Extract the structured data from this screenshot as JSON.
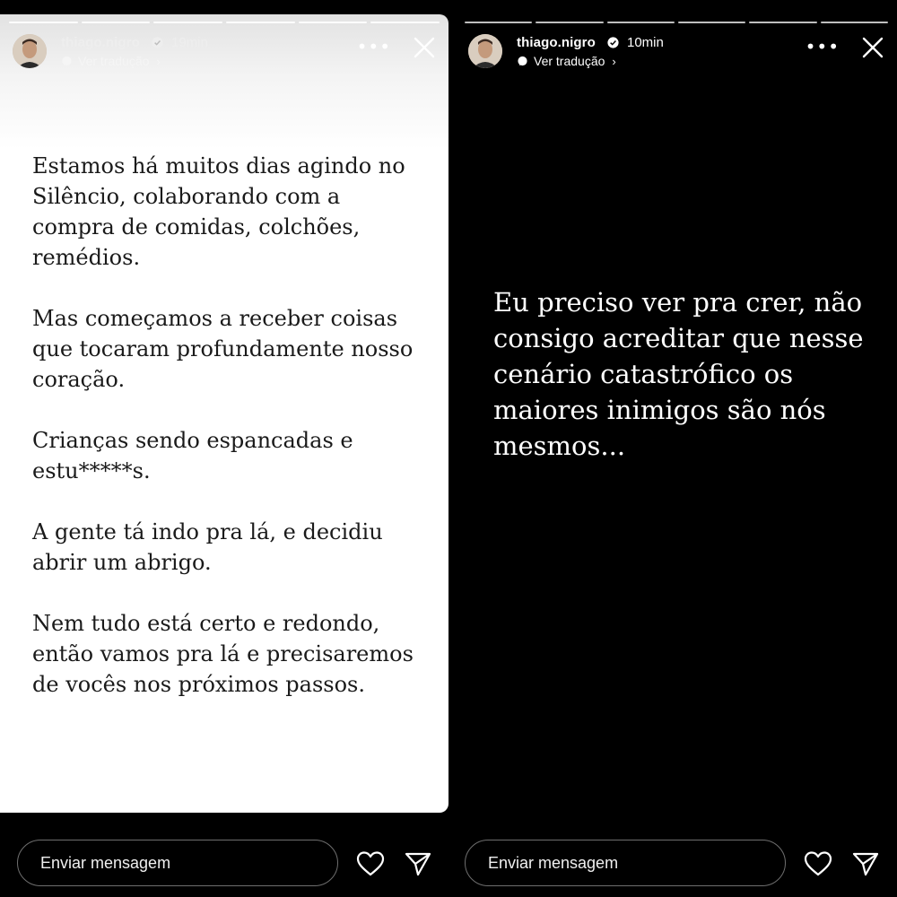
{
  "stories": [
    {
      "username": "thiago.nigro",
      "time_ago": "19min",
      "translate_label": "Ver tradução",
      "paragraphs": [
        "Estamos há muitos dias agindo no\nSilêncio, colaborando com a\ncompra de comidas, colchões,\nremédios.",
        "Mas começamos a receber coisas\nque tocaram profundamente nosso\ncoração.",
        "Crianças sendo espancadas e\nestu*****s.",
        "A gente tá indo pra lá, e decidiu\nabrir um abrigo.",
        "Nem tudo está certo e redondo,\nentão vamos pra lá e precisaremos\nde vocês nos próximos passos."
      ],
      "message_placeholder": "Enviar mensagem"
    },
    {
      "username": "thiago.nigro",
      "time_ago": "10min",
      "translate_label": "Ver tradução",
      "text": "Eu preciso ver pra crer, não\nconsigo acreditar que nesse\ncenário catastrófico os\nmaiores inimigos são nós\nmesmos...",
      "message_placeholder": "Enviar mensagem"
    }
  ],
  "icons": {
    "more": "more-options-icon",
    "close": "close-icon",
    "verified": "verified-badge-icon",
    "translate": "translate-icon",
    "like": "heart-icon",
    "share": "send-icon"
  },
  "colors": {
    "background": "#000000",
    "verified_blue": "#ffffff",
    "input_border": "#6f6f6f"
  }
}
